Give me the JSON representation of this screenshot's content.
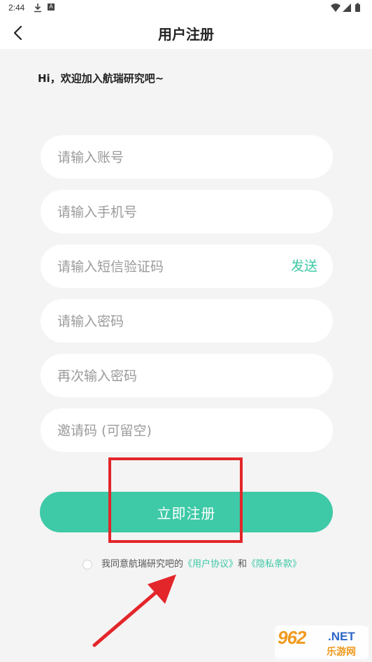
{
  "status_bar": {
    "time": "2:44",
    "download_icon": "download-icon",
    "notification_icon": "a-notification-icon",
    "wifi_icon": "wifi-icon",
    "signal_icon": "signal-icon",
    "battery_icon": "battery-icon"
  },
  "header": {
    "title": "用户注册",
    "back_icon": "chevron-left-icon"
  },
  "welcome": "Hi，欢迎加入航瑞研究吧~",
  "form": {
    "account_placeholder": "请输入账号",
    "phone_placeholder": "请输入手机号",
    "sms_placeholder": "请输入短信验证码",
    "send_label": "发送",
    "password_placeholder": "请输入密码",
    "confirm_placeholder": "再次输入密码",
    "invite_placeholder": "邀请码 (可留空)",
    "register_label": "立即注册"
  },
  "agreement": {
    "prefix": "我同意航瑞研究吧的",
    "user_agreement": "《用户协议》",
    "and": "和",
    "privacy_policy": "《隐私条款》",
    "checked": false
  },
  "annotation": {
    "highlight_color": "#e3262a",
    "arrow_color": "#e3262a"
  },
  "watermark": {
    "brand": "962",
    "domain": ".NET",
    "site": "乐游网"
  },
  "colors": {
    "accent": "#3ec9a7",
    "link": "#3cc8a6",
    "background": "#f4f4f4"
  }
}
